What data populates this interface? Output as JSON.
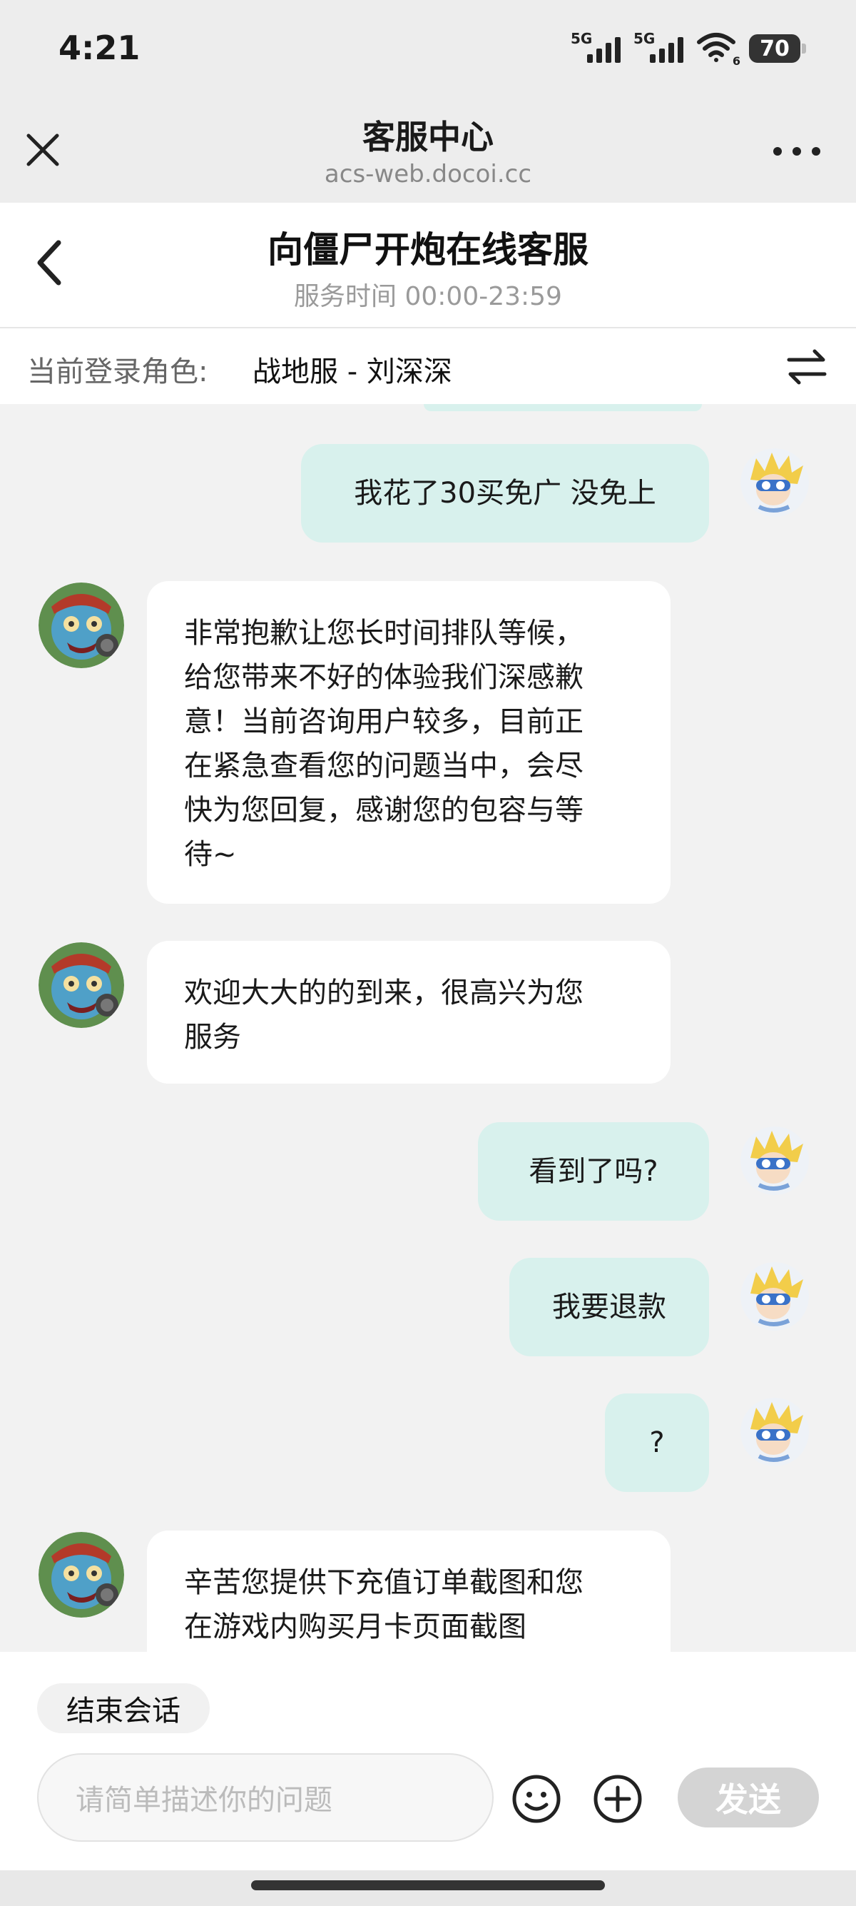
{
  "status_bar": {
    "time": "4:21",
    "signal1_label": "5G",
    "signal2_label": "5G",
    "wifi_sub": "6",
    "battery": "70"
  },
  "browser": {
    "title": "客服中心",
    "url": "acs-web.docoi.cc"
  },
  "header": {
    "title": "向僵尸开炮在线客服",
    "service_hours": "服务时间 00:00-23:59"
  },
  "role_bar": {
    "label": "当前登录角色:",
    "value": "战地服 - 刘深深"
  },
  "messages": [
    {
      "sender": "user",
      "text": "我花了30买免广 没免上"
    },
    {
      "sender": "agent",
      "text": "非常抱歉让您长时间排队等候，\n给您带来不好的体验我们深感歉\n意！当前咨询用户较多，目前正\n在紧急查看您的问题当中，会尽\n快为您回复，感谢您的包容与等\n待~"
    },
    {
      "sender": "agent",
      "text": "欢迎大大的的到来，很高兴为您\n服务"
    },
    {
      "sender": "user",
      "text": "看到了吗?"
    },
    {
      "sender": "user",
      "text": "我要退款"
    },
    {
      "sender": "user",
      "text": "?"
    },
    {
      "sender": "agent",
      "text": "辛苦您提供下充值订单截图和您\n在游戏内购买月卡页面截图"
    }
  ],
  "footer": {
    "end_session": "结束会话",
    "input_placeholder": "请简单描述你的问题",
    "send": "发送"
  },
  "icons": {
    "close": "close-icon",
    "more": "more-icon",
    "back": "back-arrow-icon",
    "switch": "switch-arrows-icon",
    "emoji": "emoji-icon",
    "plus": "plus-circle-icon"
  },
  "colors": {
    "user_bubble": "#d8f1ed",
    "agent_bubble": "#ffffff",
    "send_button_disabled": "#d4d4d4",
    "chat_background": "#f2f2f2"
  }
}
